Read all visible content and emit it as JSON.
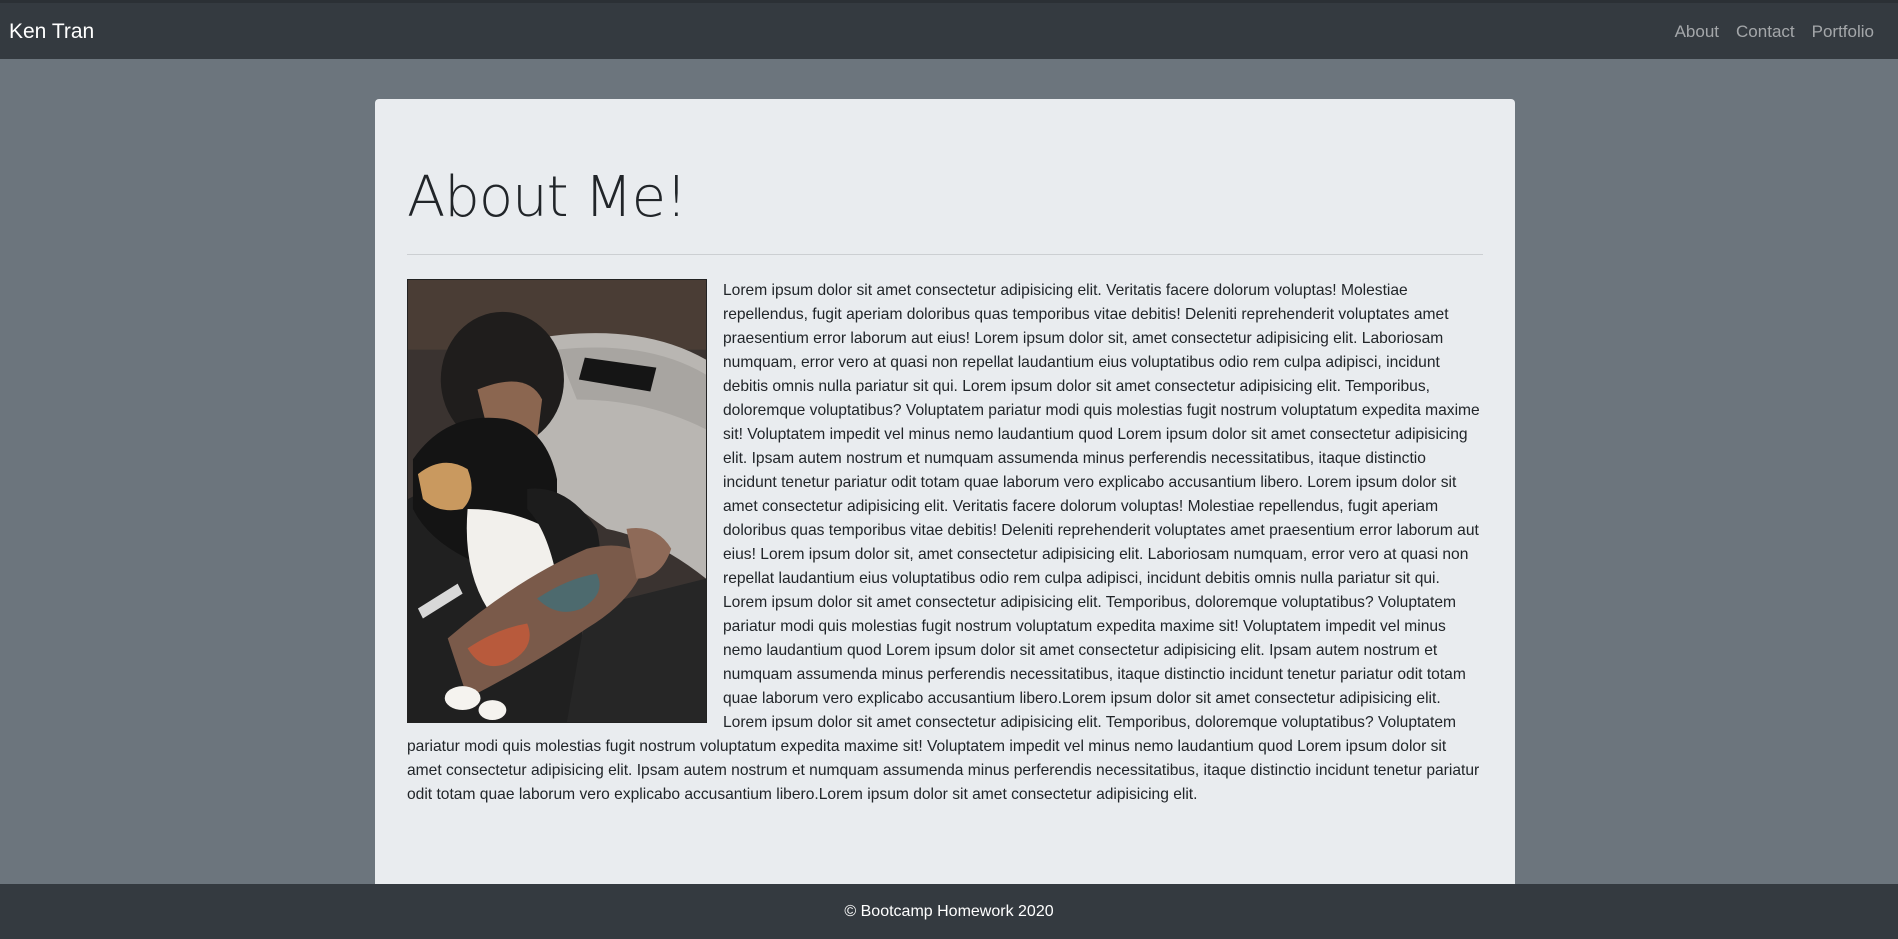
{
  "navbar": {
    "brand": "Ken Tran",
    "links": [
      "About",
      "Contact",
      "Portfolio"
    ]
  },
  "main": {
    "title": "About Me!",
    "photo_icon": "profile-photo-man-hugging-dog",
    "body": "Lorem ipsum dolor sit amet consectetur adipisicing elit. Veritatis facere dolorum voluptas! Molestiae repellendus, fugit aperiam doloribus quas temporibus vitae debitis! Deleniti reprehenderit voluptates amet praesentium error laborum aut eius! Lorem ipsum dolor sit, amet consectetur adipisicing elit. Laboriosam numquam, error vero at quasi non repellat laudantium eius voluptatibus odio rem culpa adipisci, incidunt debitis omnis nulla pariatur sit qui. Lorem ipsum dolor sit amet consectetur adipisicing elit. Temporibus, doloremque voluptatibus? Voluptatem pariatur modi quis molestias fugit nostrum voluptatum expedita maxime sit! Voluptatem impedit vel minus nemo laudantium quod Lorem ipsum dolor sit amet consectetur adipisicing elit. Ipsam autem nostrum et numquam assumenda minus perferendis necessitatibus, itaque distinctio incidunt tenetur pariatur odit totam quae laborum vero explicabo accusantium libero. Lorem ipsum dolor sit amet consectetur adipisicing elit. Veritatis facere dolorum voluptas! Molestiae repellendus, fugit aperiam doloribus quas temporibus vitae debitis! Deleniti reprehenderit voluptates amet praesentium error laborum aut eius! Lorem ipsum dolor sit, amet consectetur adipisicing elit. Laboriosam numquam, error vero at quasi non repellat laudantium eius voluptatibus odio rem culpa adipisci, incidunt debitis omnis nulla pariatur sit qui. Lorem ipsum dolor sit amet consectetur adipisicing elit. Temporibus, doloremque voluptatibus? Voluptatem pariatur modi quis molestias fugit nostrum voluptatum expedita maxime sit! Voluptatem impedit vel minus nemo laudantium quod Lorem ipsum dolor sit amet consectetur adipisicing elit. Ipsam autem nostrum et numquam assumenda minus perferendis necessitatibus, itaque distinctio incidunt tenetur pariatur odit totam quae laborum vero explicabo accusantium libero.Lorem ipsum dolor sit amet consectetur adipisicing elit. Lorem ipsum dolor sit amet consectetur adipisicing elit. Temporibus, doloremque voluptatibus? Voluptatem pariatur modi quis molestias fugit nostrum voluptatum expedita maxime sit! Voluptatem impedit vel minus nemo laudantium quod Lorem ipsum dolor sit amet consectetur adipisicing elit. Ipsam autem nostrum et numquam assumenda minus perferendis necessitatibus, itaque distinctio incidunt tenetur pariatur odit totam quae laborum vero explicabo accusantium libero.Lorem ipsum dolor sit amet consectetur adipisicing elit."
  },
  "footer": {
    "text": "© Bootcamp Homework 2020"
  },
  "colors": {
    "page_bg": "#6c757d",
    "navbar_bg": "#343a40",
    "card_bg": "#e9ecef",
    "text": "#212529"
  }
}
